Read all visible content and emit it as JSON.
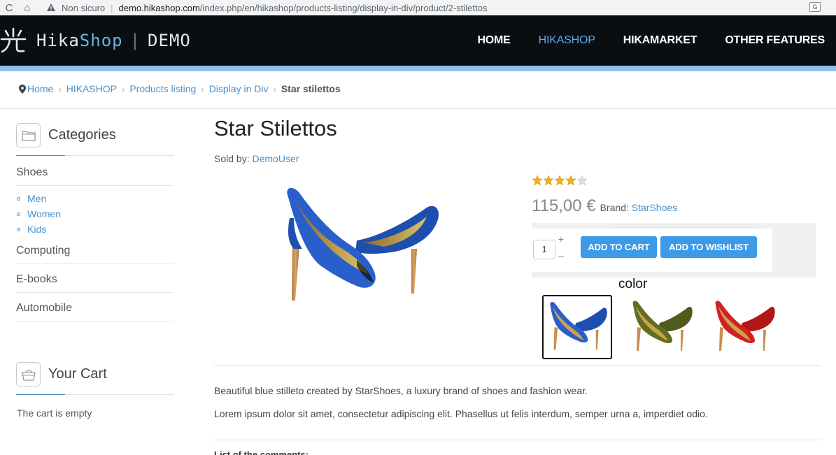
{
  "browser": {
    "security_text": "Non sicuro",
    "url_host": "demo.hikashop.com",
    "url_path": "/index.php/en/hikashop/products-listing/display-in-div/product/2-stilettos"
  },
  "site": {
    "logo_part1": "Hika",
    "logo_part2": "Shop",
    "logo_divider": "|",
    "logo_part3": "DEMO",
    "nav": [
      {
        "label": "HOME"
      },
      {
        "label": "HIKASHOP"
      },
      {
        "label": "HIKAMARKET"
      },
      {
        "label": "OTHER FEATURES"
      }
    ],
    "accent_color": "#8ec3ef",
    "link_color": "#4a90c9"
  },
  "breadcrumb": {
    "items": [
      {
        "label": "Home"
      },
      {
        "label": "HIKASHOP"
      },
      {
        "label": "Products listing"
      },
      {
        "label": "Display in Div"
      }
    ],
    "current": "Star stilettos"
  },
  "sidebar": {
    "categories_title": "Categories",
    "categories": [
      {
        "label": "Shoes"
      },
      {
        "label": "Computing"
      },
      {
        "label": "E-books"
      },
      {
        "label": "Automobile"
      }
    ],
    "subcategories": [
      {
        "label": "Men"
      },
      {
        "label": "Women"
      },
      {
        "label": "Kids"
      }
    ],
    "cart_title": "Your Cart",
    "cart_empty": "The cart is empty"
  },
  "product": {
    "title": "Star Stilettos",
    "sold_by_label": "Sold by:",
    "vendor": "DemoUser",
    "rating": 4,
    "rating_max": 5,
    "price": "115,00 €",
    "brand_label": "Brand:",
    "brand": "StarShoes",
    "quantity": "1",
    "qty_plus": "+",
    "qty_minus": "–",
    "add_to_cart": "ADD TO CART",
    "add_to_wishlist": "ADD TO WISHLIST",
    "color_label": "color",
    "colors": [
      "blue",
      "olive green",
      "red"
    ],
    "selected_color": "blue",
    "description": "Beautiful blue stilleto created by StarShoes, a luxury brand of shoes and fashion wear.",
    "lorem": "Lorem ipsum dolor sit amet, consectetur adipiscing elit. Phasellus ut felis interdum, semper urna a, imperdiet odio.",
    "comments_title": "List of the comments:"
  }
}
